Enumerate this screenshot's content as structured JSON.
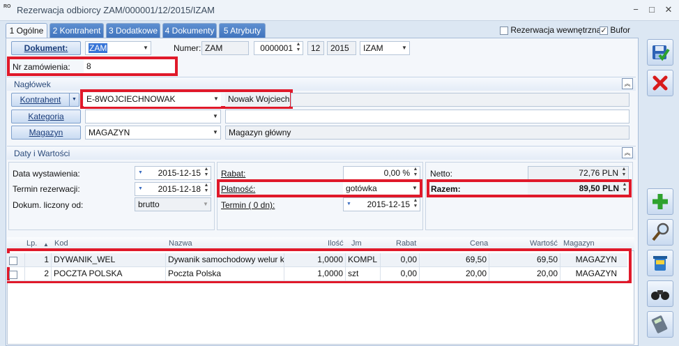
{
  "window": {
    "title": "Rezerwacja odbiorcy ZAM/000001/12/2015/IZAM",
    "app_icon": "RO",
    "minimize": "−",
    "maximize": "□",
    "close": "✕"
  },
  "tabs": [
    {
      "label": "1 Ogólne"
    },
    {
      "label": "2 Kontrahent"
    },
    {
      "label": "3 Dodatkowe"
    },
    {
      "label": "4 Dokumenty"
    },
    {
      "label": "5 Atrybuty"
    }
  ],
  "flags": {
    "internal_label": "Rezerwacja wewnętrzna",
    "internal_checked": false,
    "bufor_label": "Bufor",
    "bufor_checked": true
  },
  "document": {
    "button": "Dokument:",
    "type": "ZAM",
    "numer_label": "Numer:",
    "numer_prefix": "ZAM",
    "numer_value": "0000001",
    "month": "12",
    "year": "2015",
    "series": "IZAM",
    "order_label": "Nr zamówienia:",
    "order_value": "8"
  },
  "header_section": {
    "title": "Nagłówek",
    "kontrahent_button": "Kontrahent",
    "kontrahent_code": "E-8WOJCIECHNOWAK",
    "kontrahent_name": "Nowak Wojciech",
    "kategoria_button": "Kategoria",
    "kategoria_value": "",
    "kategoria_desc": "",
    "magazyn_button": "Magazyn",
    "magazyn_code": "MAGAZYN",
    "magazyn_name": "Magazyn główny"
  },
  "dates_section": {
    "title": "Daty i Wartości",
    "issue_label": "Data wystawienia:",
    "issue_date": "2015-12-15",
    "reserve_label": "Termin rezerwacji:",
    "reserve_date": "2015-12-18",
    "calc_label": "Dokum. liczony od:",
    "calc_value": "brutto",
    "rabat_label": "Rabat:",
    "rabat_value": "0,00 %",
    "payment_label": "Płatność:",
    "payment_value": "gotówka",
    "term_label": "Termin  (    0 dn):",
    "term_date": "2015-12-15",
    "netto_label": "Netto:",
    "netto_value": "72,76 PLN",
    "razem_label": "Razem:",
    "razem_value": "89,50 PLN"
  },
  "grid": {
    "columns": [
      "Lp.",
      "Kod",
      "Nazwa",
      "Ilość",
      "Jm",
      "Rabat",
      "Cena",
      "Wartość",
      "Magazyn"
    ],
    "rows": [
      {
        "lp": "1",
        "kod": "DYWANIK_WEL",
        "nazwa": "Dywanik samochodowy welur k...",
        "ilosc": "1,0000",
        "jm": "KOMPL",
        "rabat": "0,00",
        "cena": "69,50",
        "wartosc": "69,50",
        "magazyn": "MAGAZYN"
      },
      {
        "lp": "2",
        "kod": "POCZTA POLSKA",
        "nazwa": "Poczta Polska",
        "ilosc": "1,0000",
        "jm": "szt",
        "rabat": "0,00",
        "cena": "20,00",
        "wartosc": "20,00",
        "magazyn": "MAGAZYN"
      }
    ]
  },
  "sidebar": {
    "icons": [
      "save-icon",
      "cancel-icon",
      "add-icon",
      "search-icon",
      "delete-icon",
      "binoculars-icon",
      "calculator-icon"
    ],
    "colors": {
      "save": "#2e63b5",
      "cancel": "#d81b1b",
      "add": "#2ea22e"
    }
  },
  "colors": {
    "highlight": "#e0192a",
    "tab_blue": "#3f73bd",
    "panel": "#f4f7fb"
  }
}
